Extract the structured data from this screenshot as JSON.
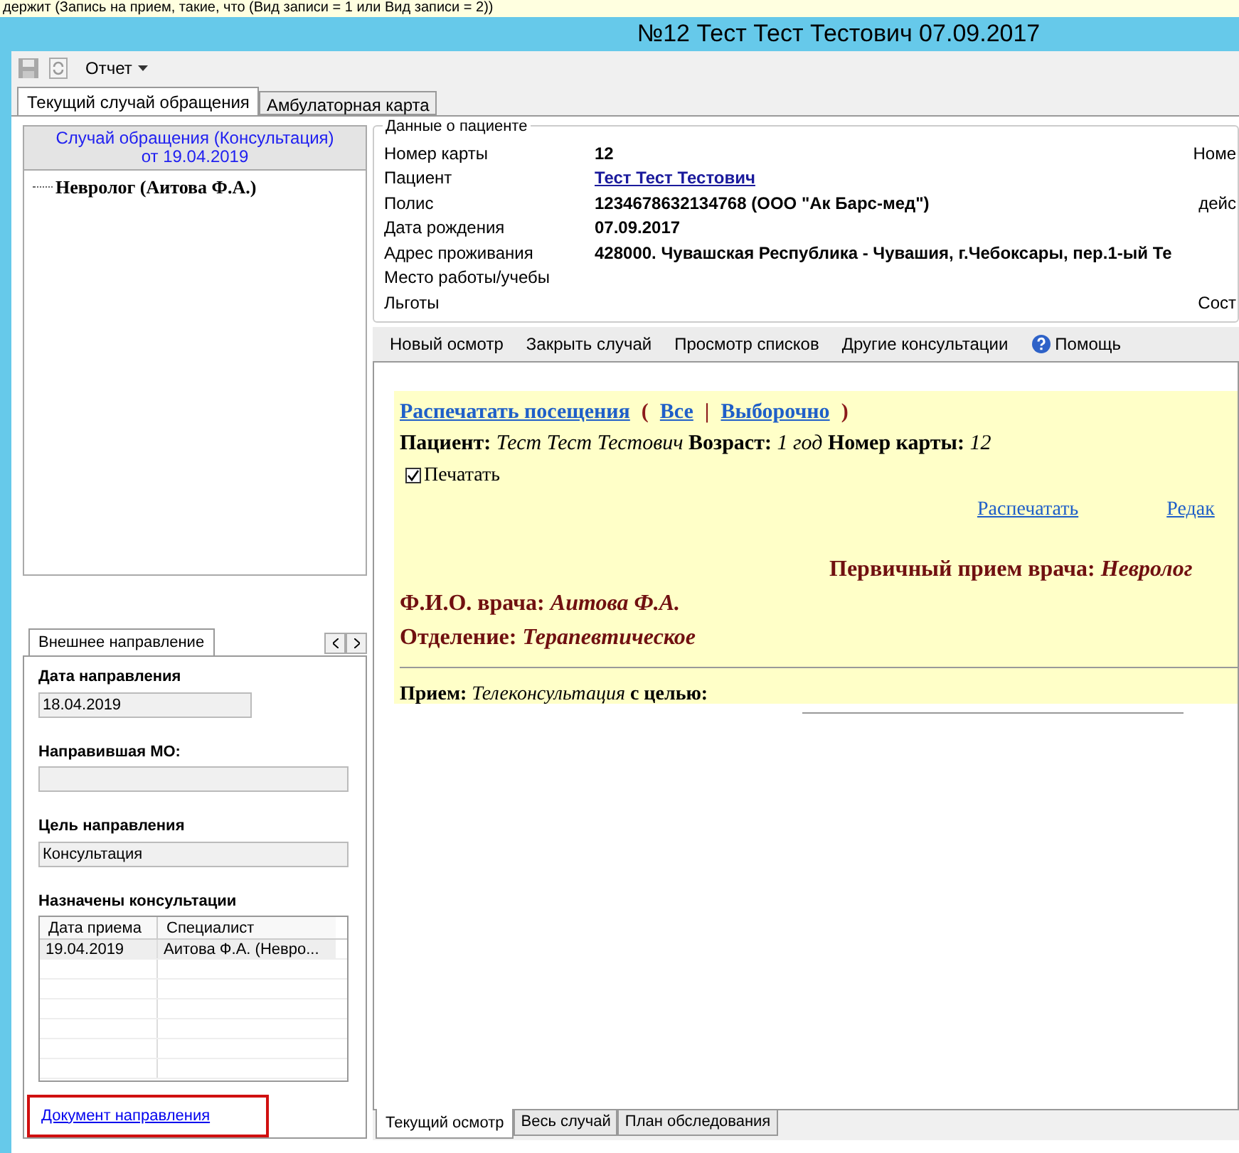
{
  "background_text": "держит (Запись на прием, такие, что (Вид записи = 1 или Вид записи = 2))",
  "window": {
    "title": "№12 Тест Тест Тестович 07.09.2017"
  },
  "toolbar": {
    "menu": "Отчет"
  },
  "tabs": [
    {
      "label": "Текущий случай обращения",
      "selected": true
    },
    {
      "label": "Амбулаторная карта",
      "selected": false
    }
  ],
  "case_panel": {
    "header": [
      "Случай обращения (Консультация)",
      "от 19.04.2019"
    ],
    "tree": [
      {
        "label": "Невролог (Аитова Ф.А.)"
      }
    ]
  },
  "referral": {
    "tabs": [
      {
        "label": "Внешнее направление",
        "selected": true
      }
    ],
    "fields": [
      {
        "label": "Дата направления",
        "value": "18.04.2019",
        "kind": "short"
      },
      {
        "label": "Направившая МО:",
        "kind": "wide"
      },
      {
        "label": "Цель направления",
        "value": "Консультация",
        "kind": "wide"
      }
    ],
    "table_title": "Назначены консультации",
    "columns": [
      "Дата приема",
      "Специалист"
    ],
    "rows": [
      [
        "19.04.2019",
        "Аитова Ф.А. (Невро..."
      ]
    ],
    "link": "Документ направления"
  },
  "patient": {
    "legend": "Данные о пациенте",
    "rows": [
      {
        "label": "Номер карты",
        "value": "12",
        "kind": "bold",
        "right": "Номе"
      },
      {
        "label": "Пациент",
        "value": "Тест Тест Тестович",
        "kind": "link"
      },
      {
        "label": "Полис",
        "value": " 1234678632134768 (ООО \"Ак Барс-мед\")",
        "kind": "bold",
        "right": "дейс"
      },
      {
        "label": "Дата рождения",
        "value": "07.09.2017",
        "kind": "bold"
      },
      {
        "label": "Адрес проживания",
        "value": "428000. Чувашская Республика - Чувашия, г.Чебоксары, пер.1-ый Те",
        "kind": "bold"
      },
      {
        "label": "Место работы/учебы"
      },
      {
        "label": "Льготы",
        "right": "Сост"
      }
    ]
  },
  "actions": [
    {
      "label": "Новый осмотр",
      "kind": "plain"
    },
    {
      "label": "Закрыть случай",
      "kind": "plain"
    },
    {
      "label": "Просмотр списков",
      "kind": "plain"
    },
    {
      "label": "Другие консультации",
      "kind": "plain"
    },
    {
      "label": "Помощь",
      "kind": "help"
    }
  ],
  "visit": {
    "print_links": [
      "Распечатать посещения",
      "(",
      "Все",
      "|",
      "Выборочно",
      ")"
    ],
    "patient_line": "**Пациент:** *Тест Тест Тестович* **Возраст:** *1 год* **Номер карты:** *12*",
    "print_checkbox": {
      "label": "Печатать",
      "checked": true
    },
    "links": [
      "Распечатать",
      "Редак"
    ],
    "heading": "Первичный прием врача: *Невролог*",
    "doctor": "Ф.И.О. врача: *Аитова Ф.А.*",
    "department": "Отделение: *Терапевтическое*",
    "reception": "**Прием:** *Телеконсультация* **с целью:**"
  },
  "bottom_tabs": [
    {
      "label": "Текущий осмотр",
      "selected": true
    },
    {
      "label": "Весь случай",
      "selected": false
    },
    {
      "label": "План обследования",
      "selected": false
    }
  ]
}
